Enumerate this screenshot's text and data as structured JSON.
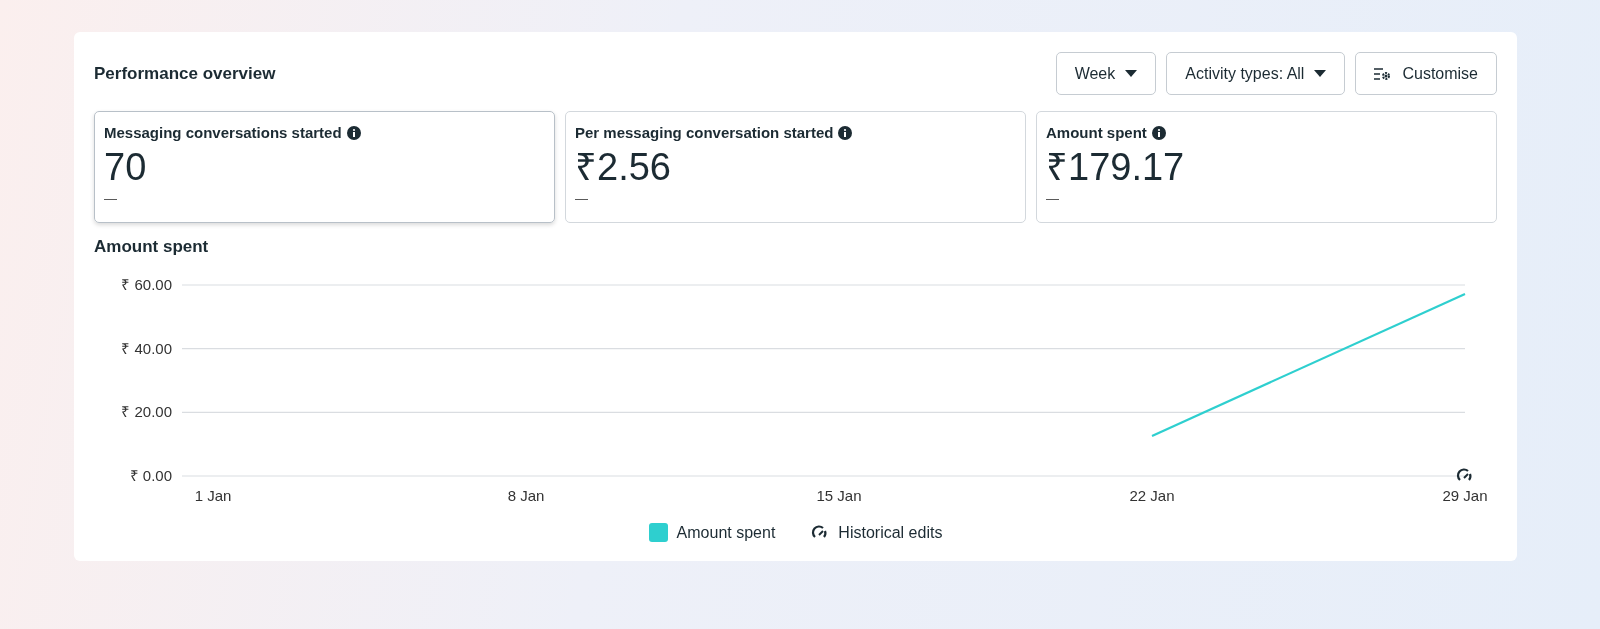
{
  "panel": {
    "title": "Performance overview"
  },
  "controls": [
    {
      "kind": "dropdown",
      "label": "Week"
    },
    {
      "kind": "dropdown",
      "label": "Activity types: All"
    },
    {
      "kind": "button",
      "label": "Customise"
    }
  ],
  "metrics": [
    {
      "label": "Messaging conversations started",
      "value": "70",
      "change": "—",
      "selected": true
    },
    {
      "label": "Per messaging conversation started",
      "value": "₹2.56",
      "change": "—",
      "selected": false
    },
    {
      "label": "Amount spent",
      "value": "₹179.17",
      "change": "—",
      "selected": false
    }
  ],
  "chart": {
    "title": "Amount spent",
    "legend": [
      {
        "kind": "edits",
        "label": "Historical edits"
      }
    ],
    "chart_data": {
      "type": "line",
      "categories": [
        "1 Jan",
        "8 Jan",
        "15 Jan",
        "22 Jan",
        "29 Jan"
      ],
      "series": [
        {
          "name": "Amount spent",
          "color": "#2ecfcf",
          "values": [
            null,
            null,
            null,
            12.6,
            57.2
          ]
        }
      ],
      "ylim": [
        0,
        60
      ],
      "yticks": [
        {
          "value": 0,
          "label": "₹ 0.00"
        },
        {
          "value": 20,
          "label": "₹ 20.00"
        },
        {
          "value": 40,
          "label": "₹ 40.00"
        },
        {
          "value": 60,
          "label": "₹ 60.00"
        }
      ]
    }
  }
}
